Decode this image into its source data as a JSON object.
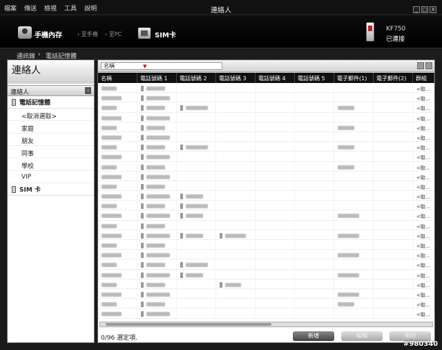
{
  "menu": [
    "檔案",
    "傳送",
    "檢視",
    "工具",
    "說明"
  ],
  "window_title": "連絡人",
  "window_controls": [
    "_",
    "□",
    "X"
  ],
  "device_bar": {
    "phone_memory": "手機內存",
    "to_phone": "› 至手機",
    "to_pc": "› 至PC",
    "sim": "SIM卡",
    "model": "KF750",
    "status": "已連接"
  },
  "breadcrumb": [
    "通訊錄",
    "›",
    "電話記憶體"
  ],
  "left_panel": {
    "title": "連絡人",
    "group_label": "連絡人",
    "collapse_glyph": "‹",
    "phone_memory": "電話記憶體",
    "items": [
      "<取消選取>",
      "家庭",
      "朋友",
      "同事",
      "學校",
      "VIP"
    ],
    "sim": "SIM 卡"
  },
  "toolbar": {
    "sort_field": "名稱",
    "sort_arrow": "▼"
  },
  "grid": {
    "columns": [
      "名稱",
      "電話號碼 1",
      "電話號碼 2",
      "電話號碼 3",
      "電話號碼 4",
      "電話號碼 5",
      "電子郵件(1)",
      "電子郵件(2)",
      "群組"
    ],
    "group_value": "<取..."
  },
  "footer": {
    "selection": "0/96 選定項.",
    "new_button": "新增",
    "edit_button": "編輯",
    "delete_button": "刪除"
  },
  "watermark": "#980340",
  "colors": {
    "chrome": "#111111",
    "grid_header": "#111111",
    "panel_bg": "#ffffff"
  }
}
